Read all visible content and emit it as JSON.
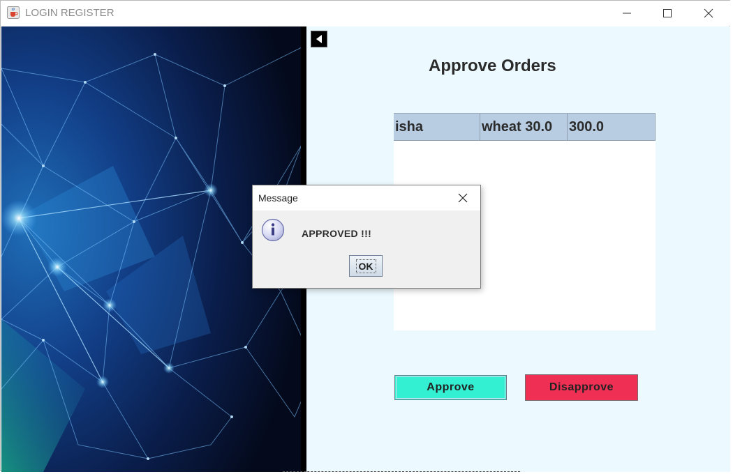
{
  "window": {
    "title": "LOGIN REGISTER",
    "icons": {
      "app": "java-cup-icon",
      "minimize": "minimize-icon",
      "maximize": "maximize-icon",
      "close": "close-icon"
    }
  },
  "main": {
    "back_icon": "back-arrow-icon",
    "title": "Approve Orders",
    "table": {
      "rows": [
        [
          "isha",
          "wheat 30.0",
          "300.0"
        ]
      ]
    },
    "approve_label": "Approve",
    "disapprove_label": "Disapprove"
  },
  "dialog": {
    "title": "Message",
    "message": "APPROVED !!!",
    "ok_label": "OK",
    "icon": "info-icon"
  },
  "colors": {
    "panel_bg": "#ecfaff",
    "table_header": "#b9cde2",
    "approve": "#33f0d2",
    "disapprove": "#ef2f53"
  }
}
